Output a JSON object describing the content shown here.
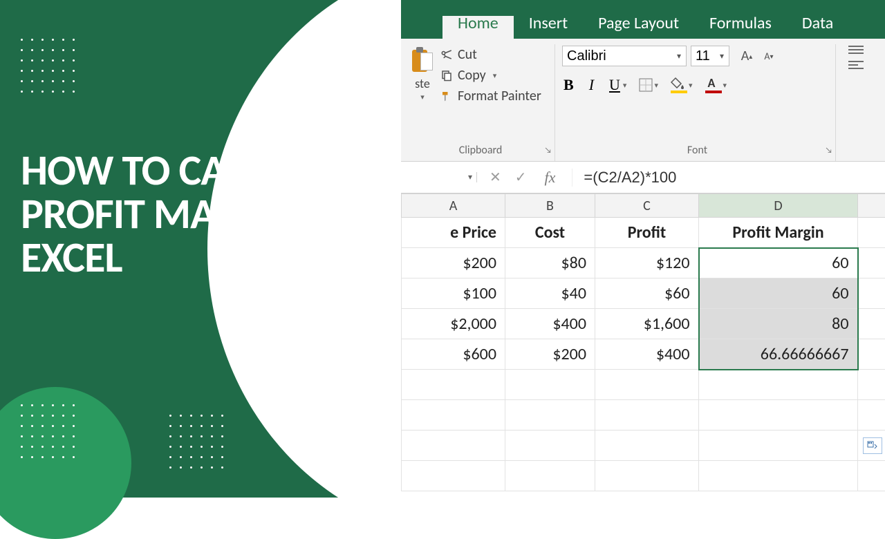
{
  "headline": "HOW TO CALCULATE PROFIT MARGIN IN EXCEL",
  "ribbon": {
    "tabs": [
      "Home",
      "Insert",
      "Page Layout",
      "Formulas",
      "Data"
    ],
    "active_tab": "Home"
  },
  "clipboard": {
    "paste_label": "ste",
    "cut_label": "Cut",
    "copy_label": "Copy",
    "format_painter_label": "Format Painter",
    "group_label": "Clipboard"
  },
  "font": {
    "group_label": "Font",
    "name": "Calibri",
    "size": "11",
    "bold": "B",
    "italic": "I",
    "underline": "U",
    "fill_color": "#ffcc00",
    "font_color": "#c00000"
  },
  "formula_bar": {
    "formula": "=(C2/A2)*100",
    "fx_icon": "fx"
  },
  "grid": {
    "columns": [
      "A",
      "B",
      "C",
      "D"
    ],
    "headers": [
      "e Price",
      "Cost",
      "Profit",
      "Profit Margin"
    ],
    "rows": [
      {
        "A": "$200",
        "B": "$80",
        "C": "$120",
        "D": "60"
      },
      {
        "A": "$100",
        "B": "$40",
        "C": "$60",
        "D": "60"
      },
      {
        "A": "$2,000",
        "B": "$400",
        "C": "$1,600",
        "D": "80"
      },
      {
        "A": "$600",
        "B": "$200",
        "C": "$400",
        "D": "66.66666667"
      }
    ]
  },
  "icons": {
    "dropdown": "▾",
    "cancel": "✕",
    "enter": "✓",
    "launcher": "↘",
    "grow_a": "A",
    "shrink_a": "A"
  }
}
